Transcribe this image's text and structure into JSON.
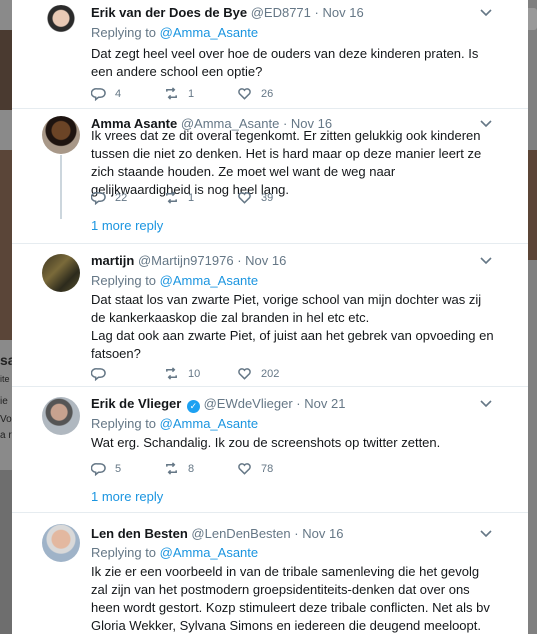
{
  "tweets": [
    {
      "name": "Erik van der Does de Bye",
      "handle": "@ED8771",
      "time": "Nov 16",
      "verified": false,
      "replying_prefix": "Replying to",
      "replying_to": "@Amma_Asante",
      "text": "Dat zegt heel veel over hoe de ouders van deze kinderen praten. Is een andere school een optie?",
      "replies": "4",
      "retweets": "1",
      "likes": "26"
    },
    {
      "name": "Amma Asante",
      "handle": "@Amma_Asante",
      "time": "Nov 16",
      "verified": false,
      "text": "Ik vrees dat ze dit overal tegenkomt. Er zitten gelukkig ook kinderen tussen die niet zo denken. Het is hard maar op deze manier leert ze zich staande houden. Ze moet wel want de weg  naar gelijkwaardigheid is nog heel lang.",
      "replies": "22",
      "retweets": "1",
      "likes": "39",
      "more_replies": "1 more reply"
    },
    {
      "name": "martijn",
      "handle": "@Martijn971976",
      "time": "Nov 16",
      "verified": false,
      "replying_prefix": "Replying to",
      "replying_to": "@Amma_Asante",
      "text_lines": [
        "Dat staat los van zwarte Piet, vorige school van mijn dochter was zij de kankerkaaskop die zal branden in hel etc etc.",
        "Lag dat ook aan zwarte Piet, of juist aan het gebrek van opvoeding en fatsoen?"
      ],
      "replies": "",
      "retweets": "10",
      "likes": "202"
    },
    {
      "name": "Erik de Vlieger",
      "handle": "@EWdeVlieger",
      "time": "Nov 21",
      "verified": true,
      "replying_prefix": "Replying to",
      "replying_to": "@Amma_Asante",
      "text": "Wat erg. Schandalig. Ik zou de screenshots op twitter zetten.",
      "replies": "5",
      "retweets": "8",
      "likes": "78",
      "more_replies": "1 more reply"
    },
    {
      "name": "Len den Besten",
      "handle": "@LenDenBesten",
      "time": "Nov 16",
      "verified": false,
      "replying_prefix": "Replying to",
      "replying_to": "@Amma_Asante",
      "text": "Ik zie er een voorbeeld in van de tribale samenleving die het gevolg zal zijn van het postmodern groepsidentiteits-denken dat over ons heen wordt gestort. Kozp stimuleert deze tribale conflicten. Net als bv Gloria Wekker, Sylvana Simons en iedereen die deugend meeloopt."
    }
  ],
  "background": {
    "left_fragments": [
      "sa",
      "ite",
      "ie",
      "Vo",
      "a ri",
      "ie"
    ]
  },
  "colors": {
    "accent": "#1b95e0",
    "muted": "#657786",
    "verified": "#1da1f2"
  },
  "icons": {
    "reply": "reply-icon",
    "retweet": "retweet-icon",
    "like": "heart-icon",
    "caret": "chevron-down-icon"
  }
}
